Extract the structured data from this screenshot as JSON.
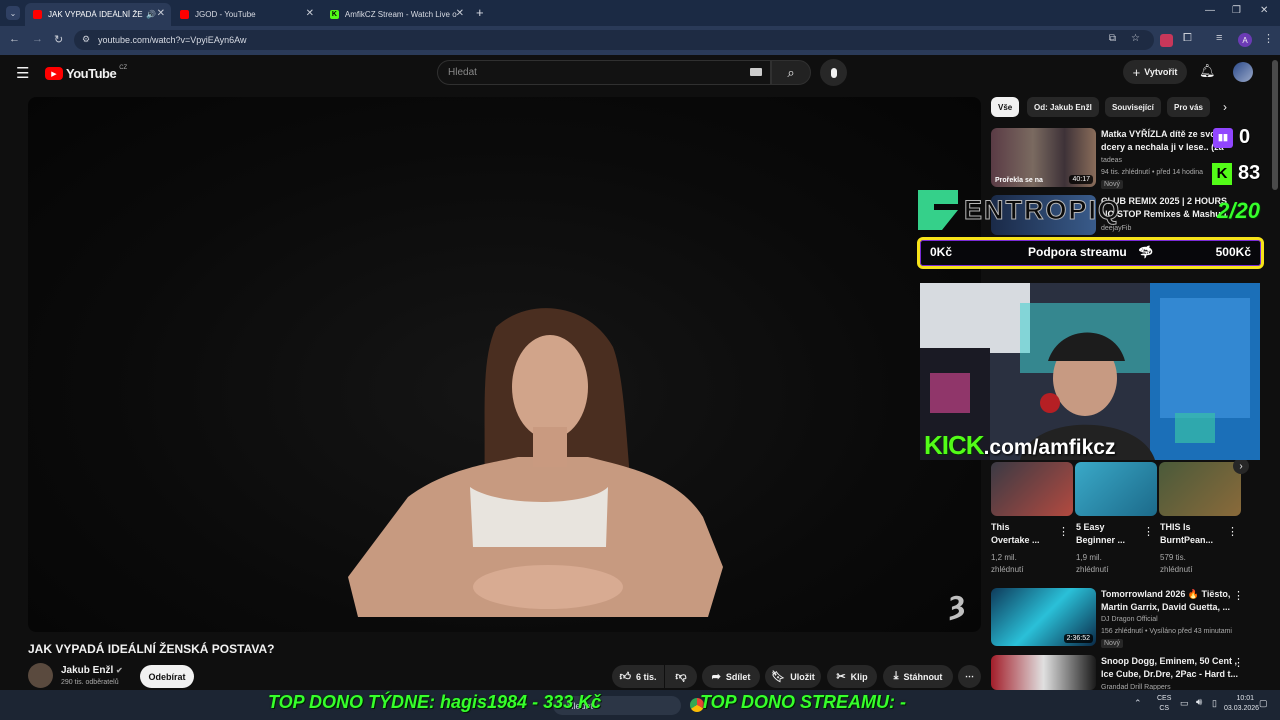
{
  "browser": {
    "tabs": [
      {
        "label": "JAK VYPADÁ IDEÁLNÍ ŽENS",
        "active": true
      },
      {
        "label": "JGOD - YouTube",
        "active": false
      },
      {
        "label": "AmfikCZ Stream - Watch Live o",
        "active": false
      }
    ],
    "url": "youtube.com/watch?v=VpyiEAyn6Aw",
    "new_tab": "+"
  },
  "header": {
    "logo_text": "YouTube",
    "region": "CZ",
    "search_placeholder": "Hledat",
    "create_label": "Vytvořit"
  },
  "video": {
    "title": "JAK VYPADÁ IDEÁLNÍ ŽENSKÁ POSTAVA?",
    "channel": "Jakub Enžl",
    "subscribers": "290 tis. odběratelů",
    "subscribe_label": "Odebírat",
    "likes": "6 tis.",
    "share_label": "Sdílet",
    "save_label": "Uložit",
    "clip_label": "Klip",
    "download_label": "Stáhnout",
    "more": "⋯"
  },
  "sidebar": {
    "chips": [
      "Vše",
      "Od: Jakub Enžl",
      "Související",
      "Pro vás"
    ],
    "items": [
      {
        "title1": "Matka VYŘÍZLA dítě ze svojí",
        "title2": "dcery a nechala ji v lese.. (za",
        "channel": "tadeas",
        "meta": "94 tis. zhlédnutí • před 14 hodina",
        "badge": "Nový",
        "duration": "40:17",
        "thumb_caption": "Prořekla se na"
      },
      {
        "title1": "CLUB REMIX 2025 | 2 HOURS",
        "title2": "NO STOP Remixes & Mashup",
        "channel": "deejayFib"
      },
      {
        "title1": "Tomorrowland 2026 🔥 Tiësto,",
        "title2": "Martin Garrix, David Guetta, ...",
        "channel": "DJ Dragon Official",
        "meta": "156 zhlédnutí • Vysíláno před 43 minutami",
        "badge": "Nový",
        "duration": "2:36:52"
      },
      {
        "title1": "Snoop Dogg, Eminem, 50 Cent ,",
        "title2": "Ice Cube, Dr.Dre, 2Pac - Hard t...",
        "channel": "Grandad Drill Rappers"
      }
    ],
    "shorts": [
      {
        "title1": "This",
        "title2": "Overtake ...",
        "meta1": "1,2 mil.",
        "meta2": "zhlédnutí"
      },
      {
        "title1": "5 Easy",
        "title2": "Beginner ...",
        "meta1": "1,9 mil.",
        "meta2": "zhlédnutí"
      },
      {
        "title1": "THIS Is",
        "title2": "BurntPean...",
        "meta1": "579 tis.",
        "meta2": "zhlédnutí"
      }
    ]
  },
  "overlay": {
    "twitch_count": "0",
    "kick_count": "83",
    "brand": "ENTROPIQ",
    "sub_goal": "2/20",
    "dono_left": "0Kč",
    "dono_center": "Podpora streamu",
    "dono_right": "500Kč",
    "kick_logo": "KICK",
    "kick_url": ".com/amfikcz",
    "dono_week": "TOP DONO TÝDNE:  hagis1984 - 333 Kč",
    "dono_stream": "TOP DONO STREAMU: -"
  },
  "taskbar": {
    "search": "Hledat",
    "lang1": "CES",
    "lang2": "CS",
    "time": "10:01",
    "date": "03.03.2026"
  },
  "colors": {
    "yt_red": "#ff0000",
    "kick_green": "#53fc18",
    "dono_green": "#36ff2b",
    "goal_yellow": "#f7e31a",
    "twitch_purple": "#9146ff"
  }
}
